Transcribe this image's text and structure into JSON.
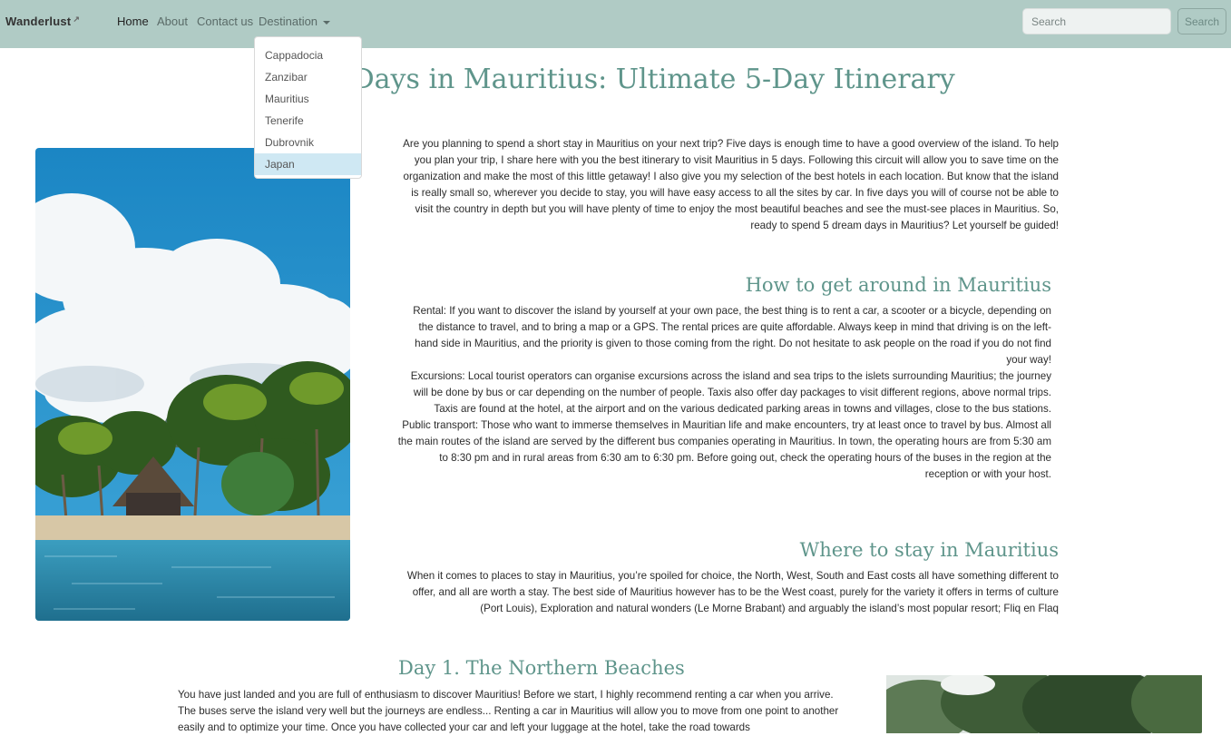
{
  "nav": {
    "brand": "Wanderlust",
    "brand_mark": "↗",
    "links": [
      "Home",
      "About",
      "Contact us",
      "Destination"
    ],
    "active": "Home",
    "search": {
      "placeholder": "Search",
      "value": "",
      "button": "Search"
    }
  },
  "dropdown": {
    "items": [
      "Cappadocia",
      "Zanzibar",
      "Mauritius",
      "Tenerife",
      "Dubrovnik",
      "Japan"
    ],
    "highlighted": "Japan"
  },
  "page": {
    "title": "5 Days in Mauritius: Ultimate 5-Day Itinerary",
    "intro": "Are you planning to spend a short stay in Mauritius on your next trip? Five days is enough time to have a good overview of the island. To help you plan your trip, I share here with you the best itinerary to visit Mauritius in 5 days. Following this circuit will allow you to save time on the organization and make the most of this little getaway! I also give you my selection of the best hotels in each location. But know that the island is really small so, wherever you decide to stay, you will have easy access to all the sites by car. In five days you will of course not be able to visit the country in depth but you will have plenty of time to enjoy the most beautiful beaches and see the must-see places in Mauritius. So, ready to spend 5 dream days in Mauritius? Let yourself be guided!",
    "section_getting_around": {
      "heading": "How to get around in Mauritius",
      "paragraphs": [
        "Rental: If you want to discover the island by yourself at your own pace, the best thing is to rent a car, a scooter or a bicycle, depending on the distance to travel, and to bring a map or a GPS. The rental prices are quite affordable. Always keep in mind that driving is on the left-hand side in Mauritius, and the priority is given to those coming from the right. Do not hesitate to ask people on the road if you do not find your way!",
        "Excursions: Local tourist operators can organise excursions across the island and sea trips to the islets surrounding Mauritius; the journey will be done by bus or car depending on the number of people. Taxis also offer day packages to visit different regions, above normal trips. Taxis are found at the hotel, at the airport and on the various dedicated parking areas in towns and villages, close to the bus stations.",
        "Public transport: Those who want to immerse themselves in Mauritian life and make encounters, try at least once to travel by bus. Almost all the main routes of the island are served by the different bus companies operating in Mauritius. In town, the operating hours are from 5:30 am to 8:30 pm and in rural areas from 6:30 am to 6:30 pm. Before going out, check the operating hours of the buses in the region at the reception or with your host."
      ]
    },
    "section_stay": {
      "heading": "Where to stay in Mauritius",
      "text": "When it comes to places to stay in Mauritius, you’re spoiled for choice, the North, West, South and East costs all have something different to offer, and all are worth a stay. The best side of Mauritius however has to be the West coast, purely for the variety it offers in terms of culture (Port Louis), Exploration and natural wonders (Le Morne Brabant) and arguably the island’s most popular resort; Fliq en Flaq"
    },
    "section_day1": {
      "heading": "Day 1. The Northern Beaches",
      "text": "You have just landed and you are full of enthusiasm to discover Mauritius! Before we start, I highly recommend renting a car when you arrive. The buses serve the island very well but the journeys are endless... Renting a car in Mauritius will allow you to move from one point to another easily and to optimize your time. Once you have collected your car and left your luggage at the hotel, take the road towards"
    }
  },
  "colors": {
    "navbar": "#b0cbc5",
    "heading": "#5f958b",
    "dropdown_highlight": "#cfe8f3"
  }
}
